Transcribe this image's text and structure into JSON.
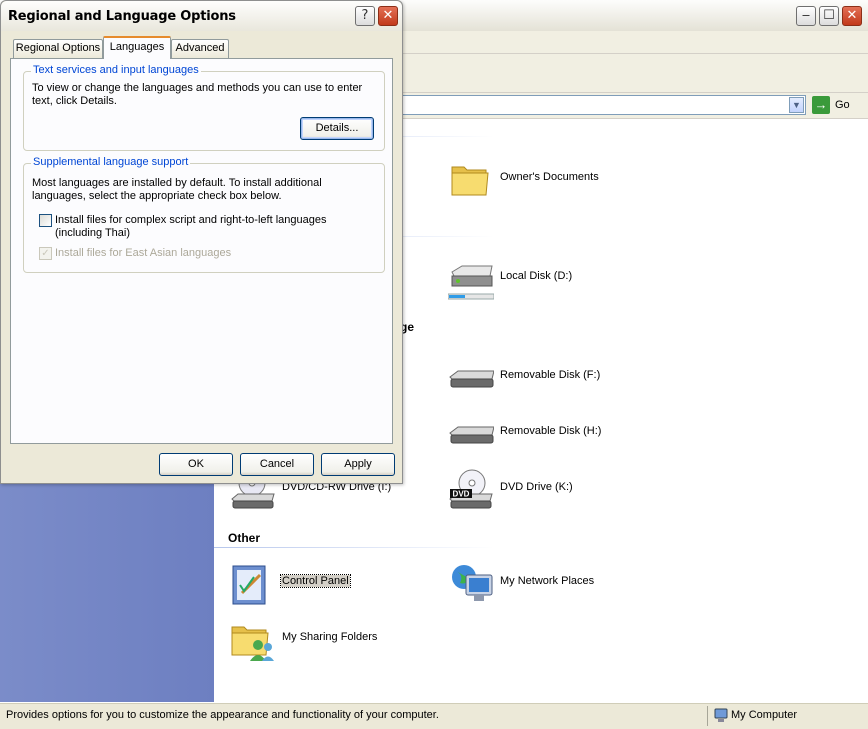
{
  "explorer": {
    "address": {
      "go_label": "Go"
    },
    "groups": [
      {
        "items": [
          {
            "label": "Owner's Documents",
            "icon": "folder-icon"
          }
        ]
      },
      {
        "items": [
          {
            "label": "Local Disk (D:)",
            "icon": "hard-disk-icon"
          }
        ]
      },
      {
        "header_partial": "ge",
        "items": [
          {
            "label": "Removable Disk (F:)",
            "icon": "removable-disk-icon"
          },
          {
            "label": "Removable Disk (H:)",
            "icon": "removable-disk-icon"
          },
          {
            "label": "DVD/CD-RW Drive (I:)",
            "icon": "cd-drive-icon"
          },
          {
            "label": "DVD Drive (K:)",
            "icon": "dvd-drive-icon",
            "badge": "DVD"
          }
        ]
      },
      {
        "header": "Other",
        "items": [
          {
            "label": "Control Panel",
            "icon": "control-panel-icon",
            "selected": true
          },
          {
            "label": "My Network Places",
            "icon": "network-places-icon"
          },
          {
            "label": "My Sharing Folders",
            "icon": "sharing-folder-icon"
          }
        ]
      }
    ],
    "statusbar": {
      "text": "Provides options for you to customize the appearance and functionality of your computer.",
      "zone": "My Computer"
    }
  },
  "dialog": {
    "title": "Regional and Language Options",
    "help_glyph": "?",
    "close_glyph": "✕",
    "tabs": [
      {
        "label": "Regional Options",
        "active": false
      },
      {
        "label": "Languages",
        "active": true
      },
      {
        "label": "Advanced",
        "active": false
      }
    ],
    "text_services": {
      "title": "Text services and input languages",
      "description": "To view or change the languages and methods you can use to enter text, click Details.",
      "details_button": "Details..."
    },
    "supplemental": {
      "title": "Supplemental language support",
      "description": "Most languages are installed by default. To install additional languages, select the appropriate check box below.",
      "checkbox_complex": {
        "label": "Install files for complex script and right-to-left languages (including Thai)",
        "checked": false
      },
      "checkbox_east_asian": {
        "label": "Install files for East Asian languages",
        "checked": true,
        "disabled": true
      }
    },
    "buttons": {
      "ok": "OK",
      "cancel": "Cancel",
      "apply": "Apply"
    }
  },
  "colors": {
    "sidebar": "#7b8cc9",
    "group_title": "#0046d5",
    "tab_highlight": "#e68b2c"
  }
}
